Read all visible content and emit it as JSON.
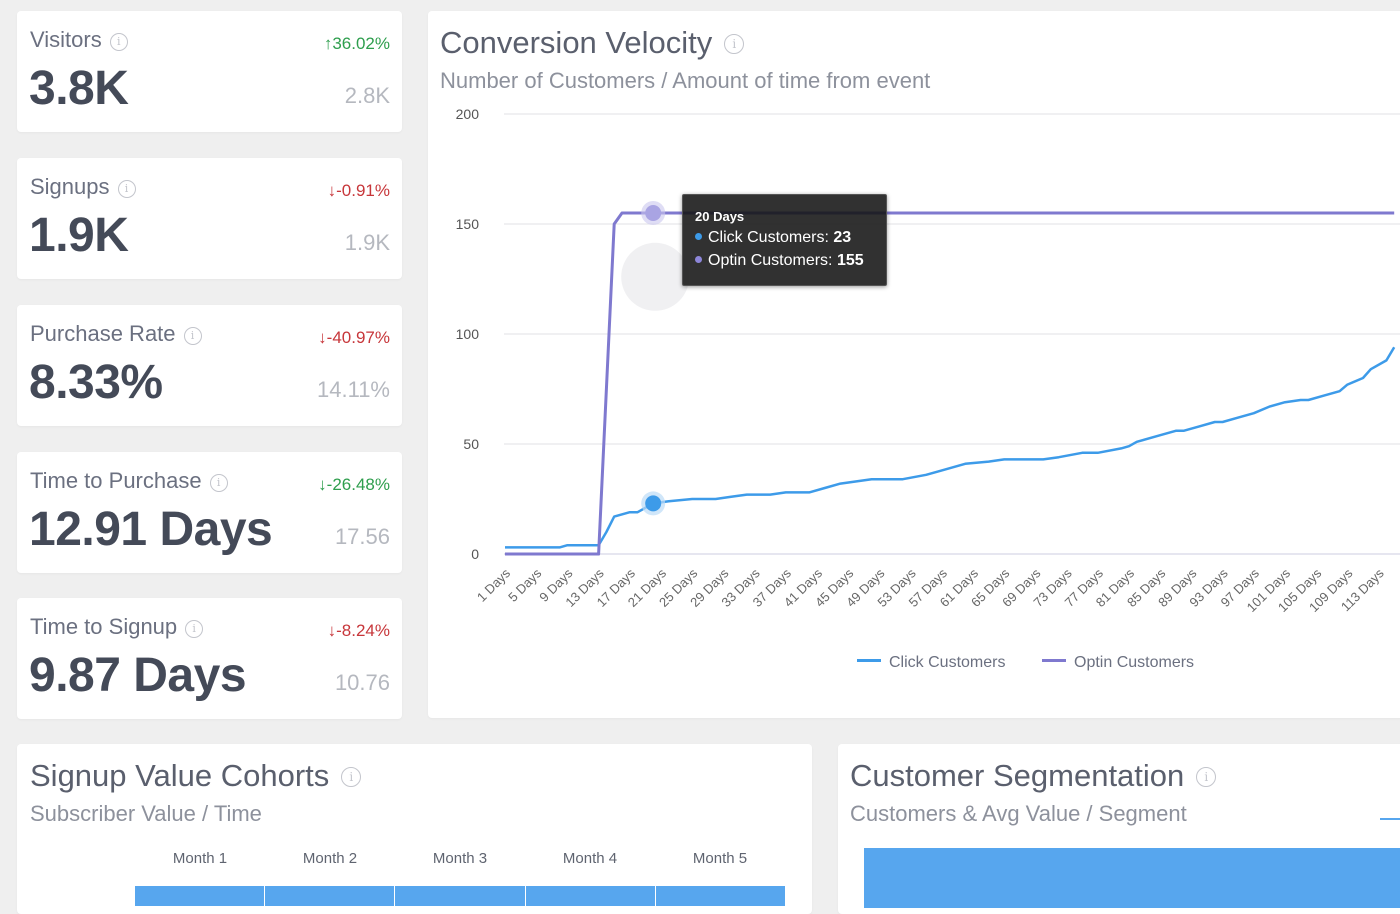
{
  "kpis": [
    {
      "label": "Visitors",
      "value": "3.8K",
      "change": "↑36.02%",
      "change_status": "good",
      "previous": "2.8K"
    },
    {
      "label": "Signups",
      "value": "1.9K",
      "change": "↓-0.91%",
      "change_status": "bad",
      "previous": "1.9K"
    },
    {
      "label": "Purchase Rate",
      "value": "8.33%",
      "change": "↓-40.97%",
      "change_status": "bad",
      "previous": "14.11%"
    },
    {
      "label": "Time to Purchase",
      "value": "12.91 Days",
      "change": "↓-26.48%",
      "change_status": "good",
      "previous": "17.56"
    },
    {
      "label": "Time to Signup",
      "value": "9.87 Days",
      "change": "↓-8.24%",
      "change_status": "bad",
      "previous": "10.76"
    }
  ],
  "info_glyph": "i",
  "conversion_velocity": {
    "title": "Conversion Velocity",
    "subtitle": "Number of Customers / Amount of time from event",
    "tooltip": {
      "title": "20 Days",
      "rows": [
        {
          "label": "Click Customers: ",
          "value": "23",
          "color": "#3d9be9"
        },
        {
          "label": "Optin Customers: ",
          "value": "155",
          "color": "#8d86d9"
        }
      ]
    },
    "legend": [
      {
        "label": "Click Customers",
        "color": "#3d9be9"
      },
      {
        "label": "Optin Customers",
        "color": "#7f79cf"
      }
    ]
  },
  "chart_data": {
    "type": "line",
    "title": "Conversion Velocity",
    "subtitle": "Number of Customers / Amount of time from event",
    "xlabel": "",
    "ylabel": "",
    "ylim": [
      0,
      200
    ],
    "yticks": [
      0,
      50,
      100,
      150,
      200
    ],
    "xlim": [
      1,
      115
    ],
    "xtick_labels": [
      "1 Days",
      "5 Days",
      "9 Days",
      "13 Days",
      "17 Days",
      "21 Days",
      "25 Days",
      "29 Days",
      "33 Days",
      "37 Days",
      "41 Days",
      "45 Days",
      "49 Days",
      "53 Days",
      "57 Days",
      "61 Days",
      "65 Days",
      "69 Days",
      "73 Days",
      "77 Days",
      "81 Days",
      "85 Days",
      "89 Days",
      "93 Days",
      "97 Days",
      "101 Days",
      "105 Days",
      "109 Days",
      "113 Days"
    ],
    "xticks": [
      1,
      5,
      9,
      13,
      17,
      21,
      25,
      29,
      33,
      37,
      41,
      45,
      49,
      53,
      57,
      61,
      65,
      69,
      73,
      77,
      81,
      85,
      89,
      93,
      97,
      101,
      105,
      109,
      113
    ],
    "grid": true,
    "legend_position": "bottom",
    "highlight_x": 20,
    "series": [
      {
        "name": "Click Customers",
        "color": "#3d9be9",
        "x": [
          1,
          8,
          9,
          12,
          13,
          14,
          15,
          17,
          18,
          20,
          22,
          25,
          28,
          30,
          32,
          35,
          37,
          40,
          42,
          44,
          48,
          52,
          55,
          57,
          60,
          63,
          65,
          70,
          72,
          75,
          77,
          80,
          81,
          82,
          85,
          87,
          88,
          90,
          92,
          93,
          95,
          97,
          99,
          101,
          103,
          104,
          106,
          108,
          109,
          111,
          112,
          114,
          115
        ],
        "y": [
          3,
          3,
          4,
          4,
          4,
          10,
          17,
          19,
          19,
          23,
          24,
          25,
          25,
          26,
          27,
          27,
          28,
          28,
          30,
          32,
          34,
          34,
          36,
          38,
          41,
          42,
          43,
          43,
          44,
          46,
          46,
          48,
          49,
          51,
          54,
          56,
          56,
          58,
          60,
          60,
          62,
          64,
          67,
          69,
          70,
          70,
          72,
          74,
          77,
          80,
          84,
          88,
          94
        ]
      },
      {
        "name": "Optin Customers",
        "color": "#7f79cf",
        "x": [
          1,
          13,
          15,
          16,
          20,
          115
        ],
        "y": [
          0,
          0,
          150,
          155,
          155,
          155
        ]
      }
    ]
  },
  "signup_value_cohorts": {
    "title": "Signup Value Cohorts",
    "subtitle": "Subscriber Value / Time",
    "columns": [
      "Month 1",
      "Month 2",
      "Month 3",
      "Month 4",
      "Month 5"
    ]
  },
  "customer_segmentation": {
    "title": "Customer Segmentation",
    "subtitle": "Customers & Avg Value / Segment"
  }
}
